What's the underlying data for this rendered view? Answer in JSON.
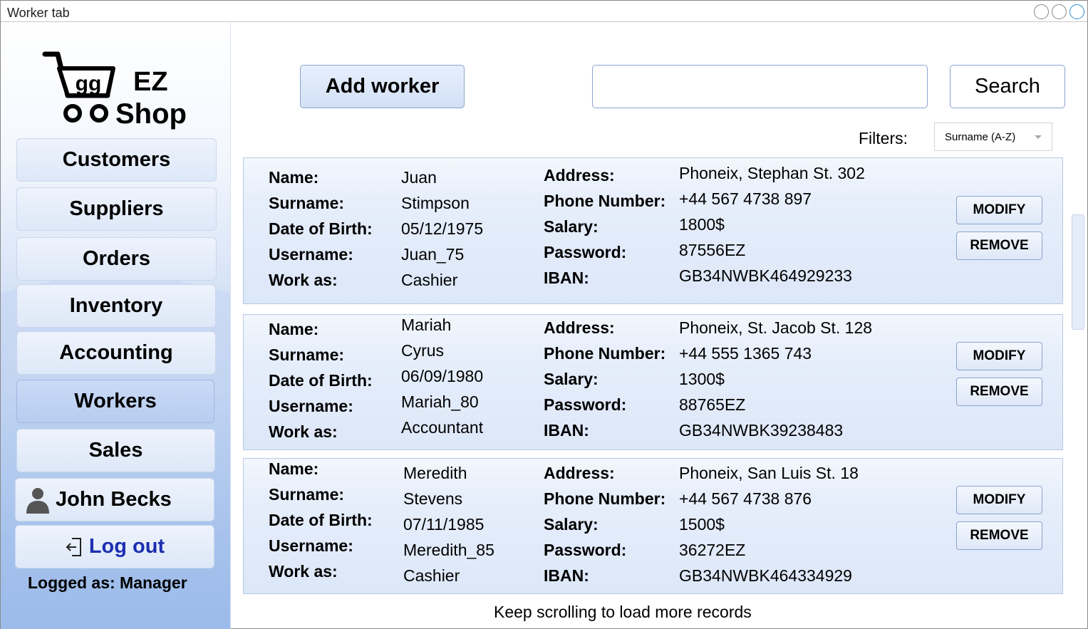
{
  "window": {
    "title": "Worker tab"
  },
  "logo": {
    "cart_text": "gg",
    "line1": "EZ",
    "line2": "Shop"
  },
  "sidebar": {
    "items": [
      {
        "label": "Customers"
      },
      {
        "label": "Suppliers"
      },
      {
        "label": "Orders"
      },
      {
        "label": "Inventory"
      },
      {
        "label": "Accounting"
      },
      {
        "label": "Workers",
        "active": true
      },
      {
        "label": "Sales"
      }
    ],
    "user_name": "John Becks",
    "logout_label": "Log out",
    "logged_as": "Logged as: Manager"
  },
  "toolbar": {
    "add_label": "Add worker",
    "search_value": "",
    "search_label": "Search",
    "filters_label": "Filters:",
    "filter_selected": "Surname (A-Z)"
  },
  "field_labels": {
    "name": "Name:",
    "surname": "Surname:",
    "dob": "Date of Birth:",
    "username": "Username:",
    "work_as": "Work as:",
    "address": "Address:",
    "phone": "Phone Number:",
    "salary": "Salary:",
    "password": "Password:",
    "iban": "IBAN:"
  },
  "actions": {
    "modify": "MODIFY",
    "remove": "REMOVE"
  },
  "workers": [
    {
      "name": "Juan",
      "surname": "Stimpson",
      "dob": "05/12/1975",
      "username": "Juan_75",
      "work_as": "Cashier",
      "address": "Phoneix, Stephan St. 302",
      "phone": "+44 567 4738 897",
      "salary": "1800$",
      "password": "87556EZ",
      "iban": "GB34NWBK464929233"
    },
    {
      "name": "Mariah",
      "surname": "Cyrus",
      "dob": "06/09/1980",
      "username": "Mariah_80",
      "work_as": "Accountant",
      "address": "Phoneix, St. Jacob St. 128",
      "phone": "+44 555 1365 743",
      "salary": "1300$",
      "password": "88765EZ",
      "iban": "GB34NWBK39238483"
    },
    {
      "name": "Meredith",
      "surname": "Stevens",
      "dob": "07/11/1985",
      "username": "Meredith_85",
      "work_as": "Cashier",
      "address": "Phoneix, San Luis St. 18",
      "phone": "+44 567 4738 876",
      "salary": "1500$",
      "password": "36272EZ",
      "iban": "GB34NWBK464334929"
    }
  ],
  "footer_note": "Keep scrolling to load more records"
}
